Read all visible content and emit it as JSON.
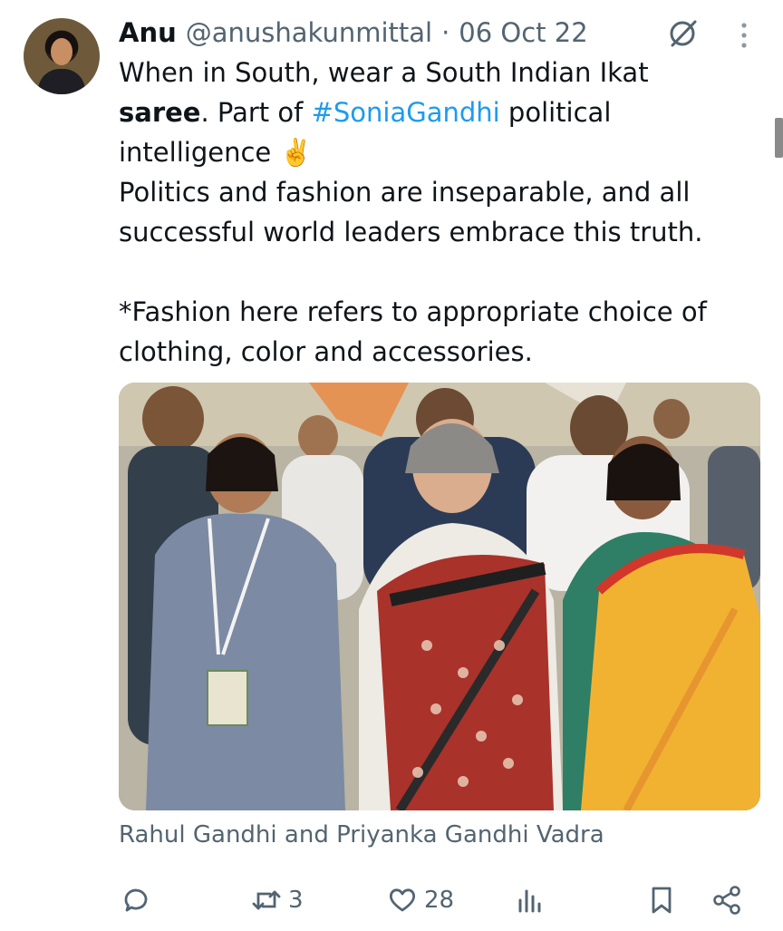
{
  "author": {
    "name": "Anu",
    "handle": "@anushakunmittal",
    "separator": "·",
    "date": "06 Oct 22"
  },
  "tweet": {
    "line1": "When in South, wear a South Indian Ikat",
    "line2_bold": "saree",
    "line2_rest": ". Part of ",
    "hashtag": "#SoniaGandhi",
    "line2_end": " political",
    "line3": "intelligence ✌️",
    "line4": "Politics and fashion are inseparable, and all",
    "line5": "successful world leaders embrace this truth.",
    "line6": "*Fashion here refers to appropriate choice of",
    "line7": "clothing, color and accessories."
  },
  "media": {
    "caption": "Rahul Gandhi and Priyanka Gandhi Vadra"
  },
  "actions": {
    "reply_count": "",
    "retweet_count": "3",
    "like_count": "28",
    "views_count": ""
  },
  "icons": {
    "header": [
      "grok-icon",
      "more-icon"
    ],
    "actions": [
      "reply-icon",
      "retweet-icon",
      "like-icon",
      "views-icon",
      "bookmark-icon",
      "share-icon"
    ]
  },
  "colors": {
    "text": "#0f1419",
    "secondary": "#536471",
    "link": "#1d9bf0"
  }
}
